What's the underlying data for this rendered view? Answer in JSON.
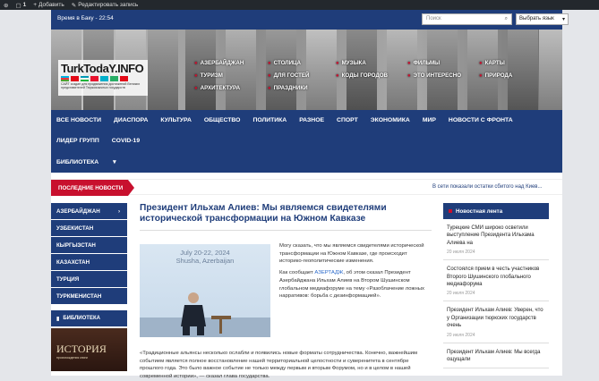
{
  "admin_bar": {
    "comments_count": "1",
    "add_label": "Добавить",
    "edit_label": "Редактировать запись"
  },
  "header": {
    "time_text": "Время в Баку - 22:54",
    "search_placeholder": "Поиск",
    "language_label": "Выбрать язык"
  },
  "logo": {
    "name": "TurkTodaY.INFO",
    "tagline": "САЙТ создан для продвижения достижений Великих представителей Тюркоязычных государств"
  },
  "banner_nav": {
    "col1": [
      "АЗЕРБАЙДЖАН",
      "ТУРИЗМ",
      "АРХИТЕКТУРА"
    ],
    "col2": [
      "СТОЛИЦА",
      "ДЛЯ ГОСТЕЙ",
      "ПРАЗДНИКИ"
    ],
    "col3": [
      "МУЗЫКА",
      "КОДЫ ГОРОДОВ"
    ],
    "col4": [
      "ФИЛЬМЫ",
      "ЭТО ИНТЕРЕСНО"
    ],
    "col5": [
      "КАРТЫ",
      "ПРИРОДА"
    ]
  },
  "main_nav": {
    "row1": [
      "ВСЕ НОВОСТИ",
      "ДИАСПОРА",
      "КУЛЬТУРА",
      "ОБЩЕСТВО",
      "ПОЛИТИКА",
      "РАЗНОЕ",
      "СПОРТ",
      "ЭКОНОМИКА",
      "МИР",
      "НОВОСТИ С ФРОНТА"
    ],
    "row2": [
      "ЛИДЕР ГРУПП",
      "COVID-19"
    ],
    "row3": [
      "БИБЛИОТЕКА"
    ]
  },
  "ticker": {
    "label": "ПОСЛЕДНИЕ НОВОСТИ",
    "text": "В сети показали остатки сбитого над Киев..."
  },
  "sidebar": {
    "items": [
      "АЗЕРБАЙДЖАН",
      "УЗБЕКИСТАН",
      "КЫРГЫЗСТАН",
      "КАЗАХСТАН",
      "ТУРЦИЯ",
      "ТУРКМЕНИСТАН"
    ],
    "library_label": "БИБЛИОТЕКА",
    "book_title": "ИСТОРИЯ",
    "book_subtitle": "происхождения книги"
  },
  "article": {
    "headline": "Президент Ильхам Алиев: Мы являемся свидетелями исторической трансформации на Южном Кавказе",
    "photo_date": "July 20-22, 2024",
    "photo_place": "Shusha, Azerbaijan",
    "para1": "Могу сказать, что мы являемся свидетелями исторической трансформации на Южном Кавказе, где происходит историко-геополитические изменения.",
    "para2_link": "АЗЕРТАДЖ",
    "para2_before": "Как сообщает ",
    "para2_after": ", об этом сказал Президент Азербайджана Ильхам Алиев на Втором Шушинском глобальном медиафоруме на тему «Разоблачение ложных нарративов: борьба с дезинформацией».",
    "para3": "«Традиционные альянсы несколько ослабли и появились новые форматы сотрудничества. Конечно, важнейшим событием является полное восстановление нашей территориальной целостности и суверенитета в сентябре прошлого года. Это было важное событие не только между первым и вторым Форумом, но и в целом в нашей современной истории», — сказал глава государства."
  },
  "feed": {
    "title": "Новостная лента",
    "items": [
      {
        "text": "Турецкие СМИ широко осветили выступление Президента Ильхама Алиева на",
        "date": "20 июля 2024"
      },
      {
        "text": "Состоялся прием в честь участников Второго Шушинского глобального медиафорума",
        "date": "20 июля 2024"
      },
      {
        "text": "Президент Ильхам Алиев: Уверен, что у Организации тюркских государств очень",
        "date": "20 июля 2024"
      },
      {
        "text": "Президент Ильхам Алиев: Мы всегда ощущали",
        "date": ""
      }
    ]
  }
}
